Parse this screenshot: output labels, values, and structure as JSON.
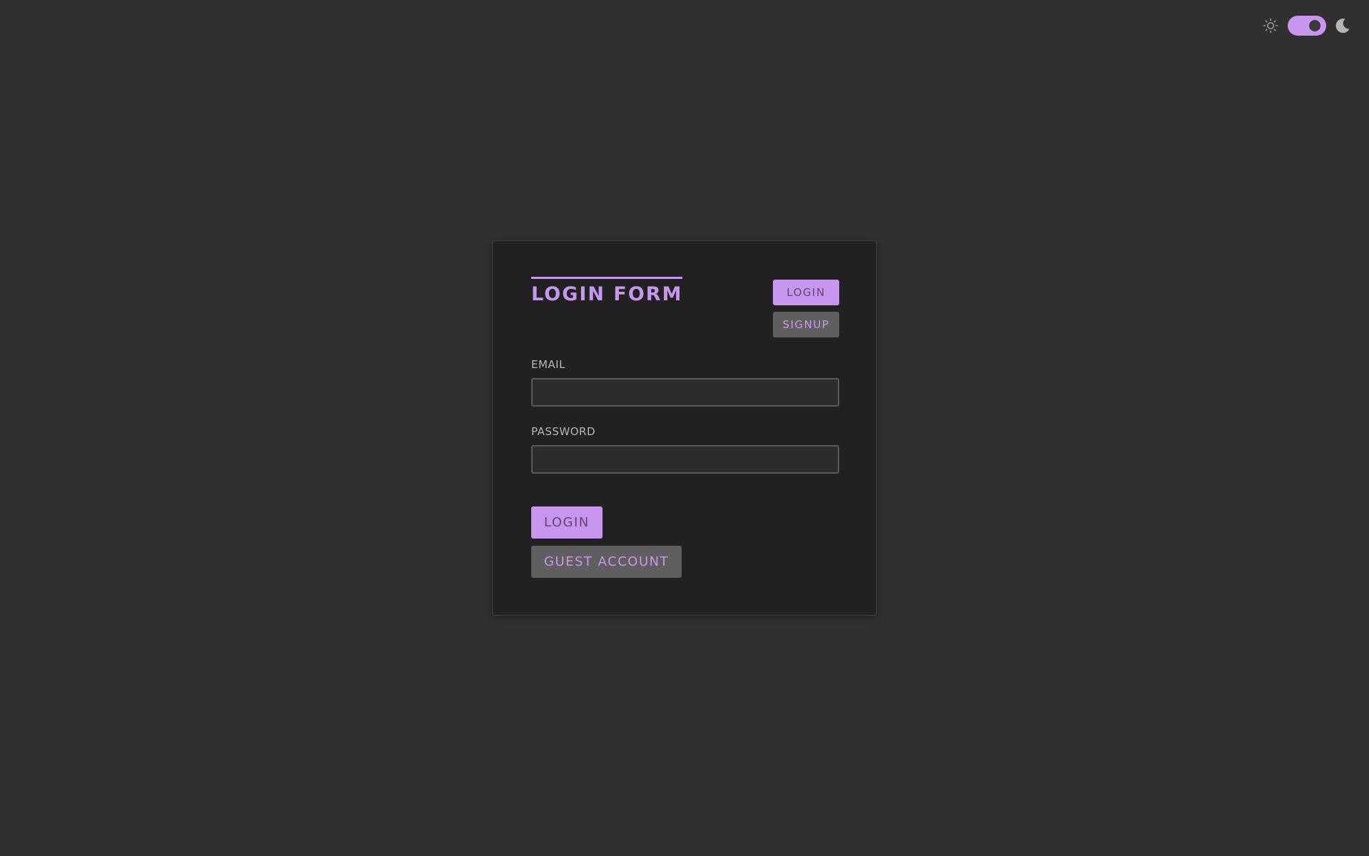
{
  "colors": {
    "page_bg": "#303030",
    "card_bg": "#212121",
    "accent": "#c896ee",
    "accent_text_dark": "#5c4a6a",
    "secondary_btn_bg": "#5f5f5f",
    "label_text": "#b8b8b8",
    "icon_gray": "#9a9a9a",
    "moon_color": "#b5b5b5"
  },
  "theme_switch": {
    "light_icon": "sun-icon",
    "dark_icon": "moon-icon",
    "dark_mode_on": true
  },
  "card": {
    "title": "LOGIN FORM",
    "mode_buttons": {
      "login_label": "LOGIN",
      "signup_label": "SIGNUP",
      "active": "login"
    },
    "email": {
      "label": "EMAIL",
      "value": "",
      "placeholder": ""
    },
    "password": {
      "label": "PASSWORD",
      "value": "",
      "placeholder": ""
    },
    "actions": {
      "login_label": "LOGIN",
      "guest_label": "GUEST ACCOUNT"
    }
  }
}
